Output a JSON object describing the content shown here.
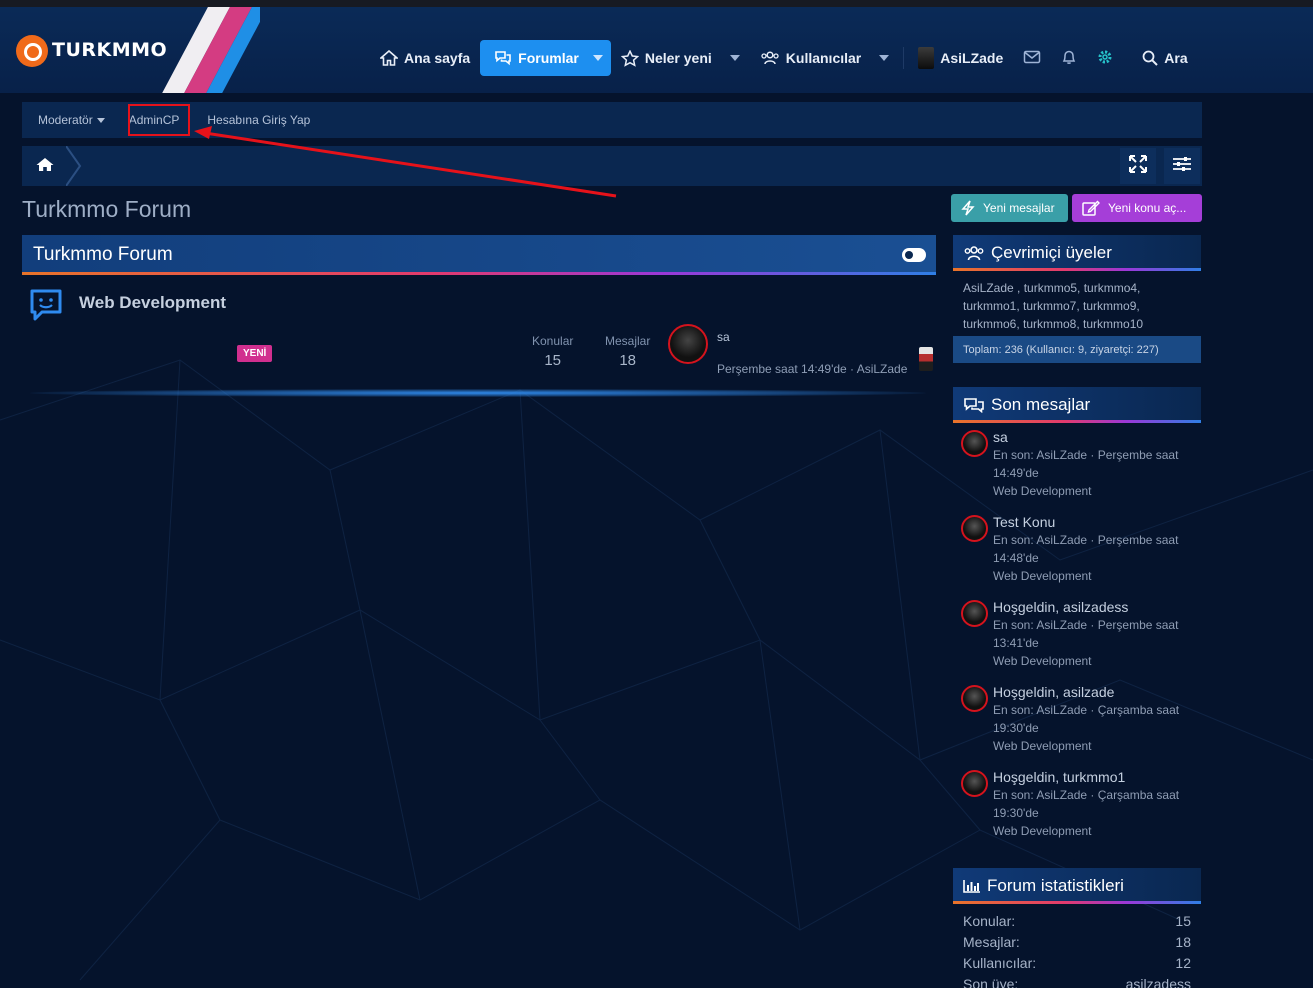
{
  "brand": {
    "name": "TURKMMO"
  },
  "nav": {
    "home": "Ana sayfa",
    "forums": "Forumlar",
    "whats_new": "Neler yeni",
    "members": "Kullanıcılar",
    "user": "AsiLZade",
    "search": "Ara"
  },
  "subnav": {
    "moderator": "Moderatör",
    "admincp": "AdminCP",
    "login_as": "Hesabına Giriş Yap"
  },
  "page": {
    "title": "Turkmmo Forum"
  },
  "actions": {
    "new_posts": "Yeni mesajlar",
    "new_thread": "Yeni konu aç..."
  },
  "forum_block": {
    "title": "Turkmmo Forum",
    "node": {
      "name": "Web Development",
      "badge": "YENİ",
      "threads_label": "Konular",
      "threads": "15",
      "messages_label": "Mesajlar",
      "messages": "18",
      "last_title": "sa",
      "last_meta": "Perşembe saat 14:49'de · AsiLZade"
    }
  },
  "online": {
    "title": "Çevrimiçi üyeler",
    "members": "AsiLZade , turkmmo5, turkmmo4, turkmmo1, turkmmo7, turkmmo9, turkmmo6, turkmmo8, turkmmo10",
    "total": "Toplam: 236 (Kullanıcı: 9, ziyaretçi: 227)"
  },
  "latest": {
    "title": "Son mesajlar",
    "posts": [
      {
        "title": "sa",
        "meta": "En son: AsiLZade · Perşembe saat 14:49'de",
        "forum": "Web Development"
      },
      {
        "title": "Test Konu",
        "meta": "En son: AsiLZade · Perşembe saat 14:48'de",
        "forum": "Web Development"
      },
      {
        "title": "Hoşgeldin, asilzadess",
        "meta": "En son: AsiLZade · Perşembe saat 13:41'de",
        "forum": "Web Development"
      },
      {
        "title": "Hoşgeldin, asilzade",
        "meta": "En son: AsiLZade · Çarşamba saat 19:30'de",
        "forum": "Web Development"
      },
      {
        "title": "Hoşgeldin, turkmmo1",
        "meta": "En son: AsiLZade · Çarşamba saat 19:30'de",
        "forum": "Web Development"
      }
    ]
  },
  "stats": {
    "title": "Forum istatistikleri",
    "rows": [
      {
        "label": "Konular:",
        "value": "15"
      },
      {
        "label": "Mesajlar:",
        "value": "18"
      },
      {
        "label": "Kullanıcılar:",
        "value": "12"
      },
      {
        "label": "Son üye:",
        "value": "asilzadess"
      }
    ]
  },
  "colors": {
    "accent": "#1d8ff0",
    "annotation_red": "#e6121a",
    "new_badge": "#d12f8f"
  }
}
